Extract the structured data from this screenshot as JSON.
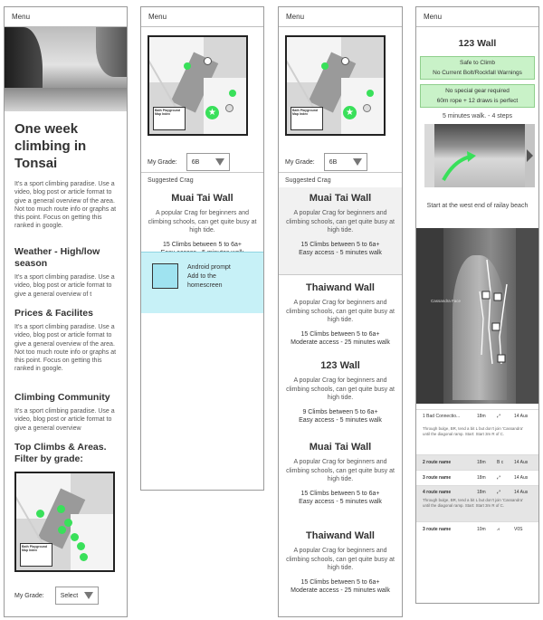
{
  "menu_label": "Menu",
  "screen1": {
    "title": "One week climbing in Tonsai",
    "intro": "It's a sport climbing paradise. Use a video, blog post or article format to give a general overview of the area. Not too much route info or graphs at this point. Focus on getting this ranked in google.",
    "weather_heading": "Weather - High/low season",
    "weather_text": "It's a sport climbing paradise. Use a video, blog post or article format to give a general overview of t",
    "prices_heading": "Prices & Facilites",
    "prices_text": "It's a sport climbing paradise. Use a video, blog post or article format to give a general overview of the area. Not too much route info or graphs at this point. Focus on getting this ranked in google.",
    "community_heading": "Climbing Community",
    "community_text": "It's a sport climbing paradise. Use a video, blog post or article format to give a general overview",
    "top_heading": "Top Climbs & Areas. Filter by grade:",
    "grade_label": "My Grade:",
    "grade_value": "Select"
  },
  "map_legend_title": "Bath Playground Map Index",
  "screen2": {
    "grade_label": "My Grade:",
    "grade_value": "6B",
    "suggested_label": "Suggested Crag",
    "crag": {
      "name": "Muai Tai Wall",
      "desc": "A popular Crag for beginners and climbing schools, can get quite busy at high tide.",
      "climbs": "15 Climbs  between 5 to 6a+",
      "access": "Easy access - 5 minutes walk"
    },
    "prompt_line1": "Android prompt",
    "prompt_line2": "Add to the",
    "prompt_line3": "homescreen"
  },
  "screen3": {
    "grade_label": "My Grade:",
    "grade_value": "6B",
    "suggested_label": "Suggested Crag",
    "crags": [
      {
        "name": "Muai Tai Wall",
        "desc": "A popular Crag for beginners and climbing schools, can get quite busy at high tide.",
        "climbs": "15 Climbs  between 5 to 6a+",
        "access": "Easy access - 5 minutes walk"
      },
      {
        "name": "Thaiwand Wall",
        "desc": "A popular Crag for beginners and climbing schools, can get quite busy at high tide.",
        "climbs": "15 Climbs  between 5 to 6a+",
        "access": "Moderate access - 25 minutes walk"
      },
      {
        "name": "123 Wall",
        "desc": "A popular Crag for beginners and climbing schools, can get quite busy at high tide.",
        "climbs": "9 Climbs  between 5 to 6a+",
        "access": "Easy access - 5 minutes walk"
      },
      {
        "name": "Muai Tai Wall",
        "desc": "A popular Crag for beginners and climbing schools, can get quite busy at high tide.",
        "climbs": "15 Climbs  between 5 to 6a+",
        "access": "Easy access - 5 minutes walk"
      },
      {
        "name": "Thaiwand Wall",
        "desc": "A popular Crag for beginners and climbing schools, can get quite busy at high tide.",
        "climbs": "15 Climbs  between 5 to 6a+",
        "access": "Moderate access - 25 minutes walk"
      }
    ]
  },
  "screen4": {
    "title": "123 Wall",
    "safety_line1": "Safe to Climb",
    "safety_line2": "No Current Bolt/Rockfall Warnings",
    "gear_line1": "No special gear required",
    "gear_line2": "60m rope + 12 draws is perfect",
    "walk": "5 minutes walk. - 4 steps",
    "start": "Start at the west end of railay beach",
    "crag_caption": "Cassandra Face",
    "routes": [
      {
        "name": "1 Bad Connectio...",
        "length": "18m",
        "grade": "",
        "bolts": "14 Aus",
        "desc": "Through bulge, BR, tend a bit L but don't join 'Cassandra' until the diagonal ramp. Start: Start 3m R of C."
      },
      {
        "name": "2 route name",
        "length": "18m",
        "grade": "B c",
        "bolts": "14 Aus",
        "desc": ""
      },
      {
        "name": "3 route name",
        "length": "18m",
        "grade": "",
        "bolts": "14 Aus",
        "desc": ""
      },
      {
        "name": "4 route name",
        "length": "18m",
        "grade": "",
        "bolts": "14 Aus",
        "desc": "Through bulge, BR, tend a bit L but don't join 'Cassandra' until the diagonal ramp. Start: Start 3m R of C."
      },
      {
        "name": "3 route name",
        "length": "10m",
        "grade": "",
        "bolts": "V0S",
        "desc": ""
      }
    ]
  },
  "colors": {
    "green_marker": "#39e05a",
    "green_box": "#c9f2c8",
    "prompt_bg": "#c7f1f7"
  }
}
